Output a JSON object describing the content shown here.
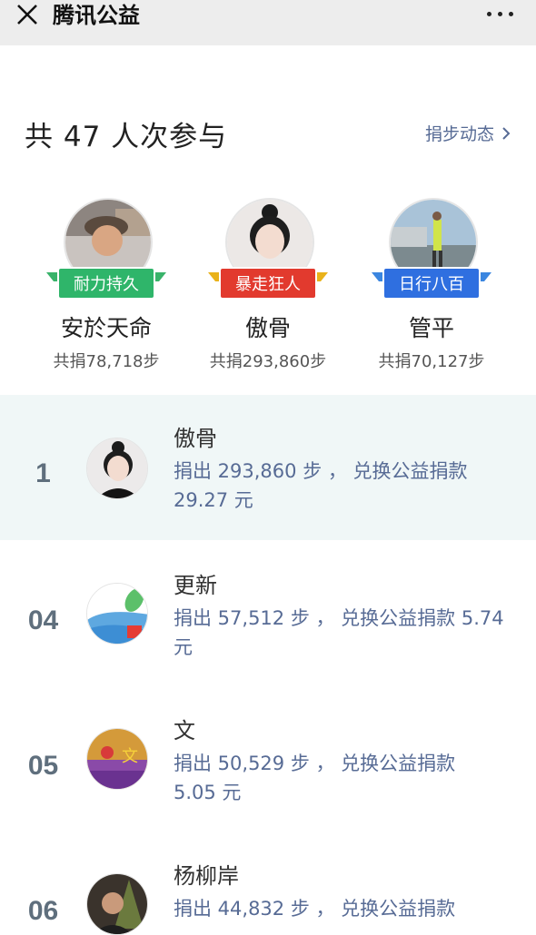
{
  "nav": {
    "title": "腾讯公益"
  },
  "header": {
    "participants": "共 47 人次参与",
    "dynamics_link": "捐步动态"
  },
  "podium": [
    {
      "name": "安於天命",
      "badge": "耐力持久",
      "steps": "共捐78,718步",
      "badge_color": "#2fb56a"
    },
    {
      "name": "傲骨",
      "badge": "暴走狂人",
      "steps": "共捐293,860步",
      "badge_color": "#e23a2e"
    },
    {
      "name": "管平",
      "badge": "日行八百",
      "steps": "共捐70,127步",
      "badge_color": "#2f6fe0"
    }
  ],
  "list": [
    {
      "rank": "1",
      "name": "傲骨",
      "detail": "捐出 293,860 步 ， 兑换公益捐款 29.27 元"
    },
    {
      "rank": "04",
      "name": "更新",
      "detail": "捐出 57,512 步 ， 兑换公益捐款 5.74 元"
    },
    {
      "rank": "05",
      "name": "文",
      "detail": "捐出 50,529 步 ， 兑换公益捐款 5.05 元"
    },
    {
      "rank": "06",
      "name": "杨柳岸",
      "detail": "捐出 44,832 步 ， 兑换公益捐款"
    }
  ]
}
